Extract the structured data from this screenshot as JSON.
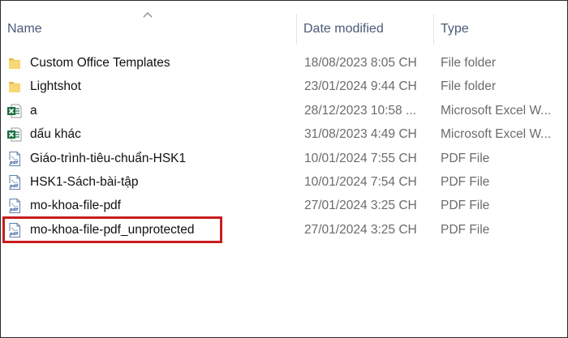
{
  "columns": {
    "name": "Name",
    "date_modified": "Date modified",
    "type": "Type"
  },
  "files": [
    {
      "name": "Custom Office Templates",
      "date": "18/08/2023 8:05 CH",
      "type": "File folder",
      "icon": "folder-icon"
    },
    {
      "name": "Lightshot",
      "date": "23/01/2024 9:44 CH",
      "type": "File folder",
      "icon": "folder-icon"
    },
    {
      "name": "a",
      "date": "28/12/2023 10:58 ...",
      "type": "Microsoft Excel W...",
      "icon": "excel-file-icon"
    },
    {
      "name": "dấu khác",
      "date": "31/08/2023 4:49 CH",
      "type": "Microsoft Excel W...",
      "icon": "excel-file-icon"
    },
    {
      "name": "Giáo-trình-tiêu-chuẩn-HSK1",
      "date": "10/01/2024 7:55 CH",
      "type": "PDF File",
      "icon": "pdf-file-icon"
    },
    {
      "name": "HSK1-Sách-bài-tập",
      "date": "10/01/2024 7:54 CH",
      "type": "PDF File",
      "icon": "pdf-file-icon"
    },
    {
      "name": "mo-khoa-file-pdf",
      "date": "27/01/2024 3:25 CH",
      "type": "PDF File",
      "icon": "pdf-file-icon"
    },
    {
      "name": "mo-khoa-file-pdf_unprotected",
      "date": "27/01/2024 3:25 CH",
      "type": "PDF File",
      "icon": "pdf-file-icon"
    }
  ],
  "colors": {
    "header_text": "#4a5a78",
    "highlight_border": "#c81d1d",
    "folder": "#f8d775",
    "excel": "#1d7044"
  }
}
